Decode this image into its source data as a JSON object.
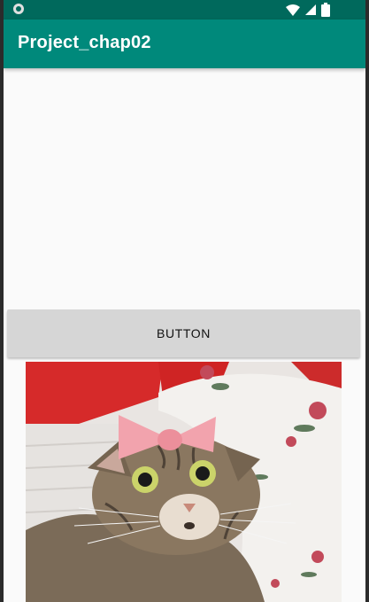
{
  "app": {
    "title": "Project_chap02"
  },
  "main": {
    "button_label": "BUTTON",
    "image": {
      "icon": "cat-photo-with-pink-bow"
    }
  },
  "status_bar": {
    "icons": [
      "notification-dot-icon",
      "wifi-icon",
      "signal-icon",
      "battery-icon"
    ]
  },
  "colors": {
    "status_bar": "#00695c",
    "app_bar": "#00897b",
    "background": "#fafafa",
    "button": "#d6d6d6"
  }
}
